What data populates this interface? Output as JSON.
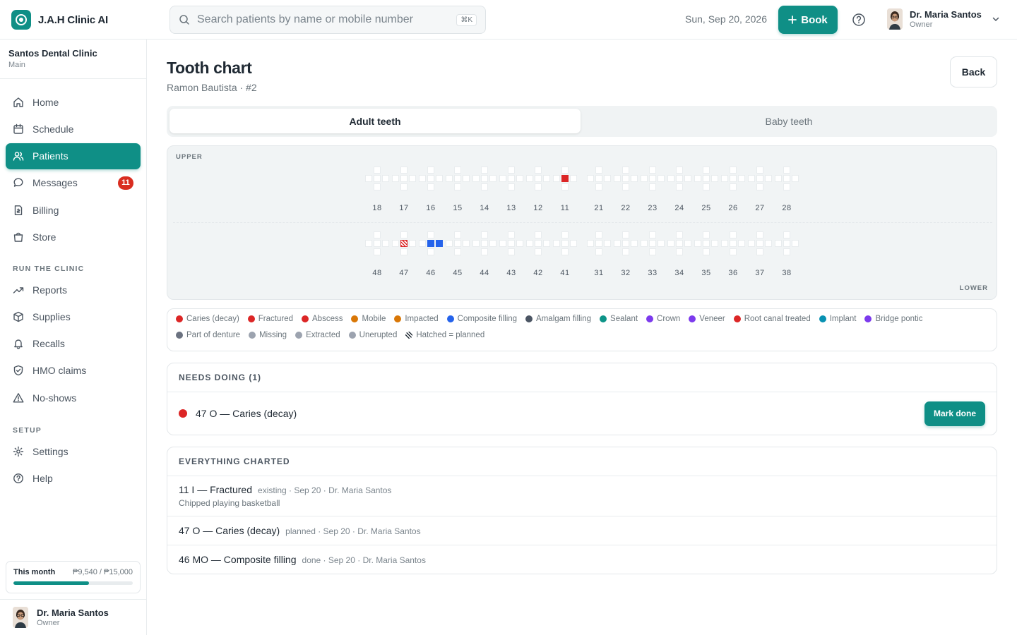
{
  "app": {
    "name": "J.A.H Clinic AI"
  },
  "search": {
    "placeholder": "Search patients by name or mobile number",
    "shortcut": "⌘K"
  },
  "topbar": {
    "date": "Sun, Sep 20, 2026",
    "book_label": "Book"
  },
  "user": {
    "name": "Dr. Maria Santos",
    "role": "Owner"
  },
  "clinic": {
    "name": "Santos Dental Clinic",
    "branch": "Main"
  },
  "sidebar": {
    "items": [
      {
        "label": "Home",
        "icon": "home-icon"
      },
      {
        "label": "Schedule",
        "icon": "calendar-icon"
      },
      {
        "label": "Patients",
        "icon": "users-icon",
        "active": true
      },
      {
        "label": "Messages",
        "icon": "chat-icon",
        "badge": "11"
      },
      {
        "label": "Billing",
        "icon": "billing-icon"
      },
      {
        "label": "Store",
        "icon": "bag-icon"
      }
    ],
    "run_section": "RUN THE CLINIC",
    "run_items": [
      {
        "label": "Reports",
        "icon": "trend-icon"
      },
      {
        "label": "Supplies",
        "icon": "box-icon"
      },
      {
        "label": "Recalls",
        "icon": "bell-icon"
      },
      {
        "label": "HMO claims",
        "icon": "shield-icon"
      },
      {
        "label": "No-shows",
        "icon": "warning-icon"
      }
    ],
    "setup_section": "SETUP",
    "setup_items": [
      {
        "label": "Settings",
        "icon": "gear-icon"
      },
      {
        "label": "Help",
        "icon": "help-icon"
      }
    ],
    "month": {
      "label": "This month",
      "value": "₱9,540 / ₱15,000",
      "progress": 0.636
    }
  },
  "page": {
    "title": "Tooth chart",
    "subtitle": "Ramon Bautista · #2",
    "back_label": "Back"
  },
  "tabs": [
    {
      "label": "Adult teeth",
      "active": true
    },
    {
      "label": "Baby teeth",
      "active": false
    }
  ],
  "chart": {
    "upper_label": "UPPER",
    "lower_label": "LOWER",
    "upper_right": [
      "18",
      "17",
      "16",
      "15",
      "14",
      "13",
      "12",
      "11"
    ],
    "upper_left": [
      "21",
      "22",
      "23",
      "24",
      "25",
      "26",
      "27",
      "28"
    ],
    "lower_right": [
      "48",
      "47",
      "46",
      "45",
      "44",
      "43",
      "42",
      "41"
    ],
    "lower_left": [
      "31",
      "32",
      "33",
      "34",
      "35",
      "36",
      "37",
      "38"
    ],
    "marks": [
      {
        "tooth": "11",
        "surfaces": [
          "center"
        ],
        "style": "red"
      },
      {
        "tooth": "47",
        "surfaces": [
          "center"
        ],
        "style": "hatch-red"
      },
      {
        "tooth": "46",
        "surfaces": [
          "center",
          "right"
        ],
        "style": "blue"
      }
    ]
  },
  "legend": [
    {
      "label": "Caries (decay)",
      "color": "#dc2626"
    },
    {
      "label": "Fractured",
      "color": "#dc2626"
    },
    {
      "label": "Abscess",
      "color": "#dc2626"
    },
    {
      "label": "Mobile",
      "color": "#d97706"
    },
    {
      "label": "Impacted",
      "color": "#d97706"
    },
    {
      "label": "Composite filling",
      "color": "#2563eb"
    },
    {
      "label": "Amalgam filling",
      "color": "#4b5563"
    },
    {
      "label": "Sealant",
      "color": "#0d9488"
    },
    {
      "label": "Crown",
      "color": "#7c3aed"
    },
    {
      "label": "Veneer",
      "color": "#7c3aed"
    },
    {
      "label": "Root canal treated",
      "color": "#dc2626"
    },
    {
      "label": "Implant",
      "color": "#0891b2"
    },
    {
      "label": "Bridge pontic",
      "color": "#7c3aed"
    },
    {
      "label": "Part of denture",
      "color": "#6b7280"
    },
    {
      "label": "Missing",
      "color": "#9ca3af"
    },
    {
      "label": "Extracted",
      "color": "#9ca3af"
    },
    {
      "label": "Unerupted",
      "color": "#9ca3af"
    },
    {
      "label": "Hatched = planned",
      "color": "hatched"
    }
  ],
  "needs_doing": {
    "header": "NEEDS DOING (1)",
    "items": [
      {
        "text": "47 O — Caries (decay)",
        "button": "Mark done"
      }
    ]
  },
  "charted": {
    "header": "EVERYTHING CHARTED",
    "items": [
      {
        "title": "11 I — Fractured",
        "meta": "existing · Sep 20 · Dr. Maria Santos",
        "note": "Chipped playing basketball"
      },
      {
        "title": "47 O — Caries (decay)",
        "meta": "planned · Sep 20 · Dr. Maria Santos"
      },
      {
        "title": "46 MO — Composite filling",
        "meta": "done · Sep 20 · Dr. Maria Santos"
      }
    ]
  }
}
